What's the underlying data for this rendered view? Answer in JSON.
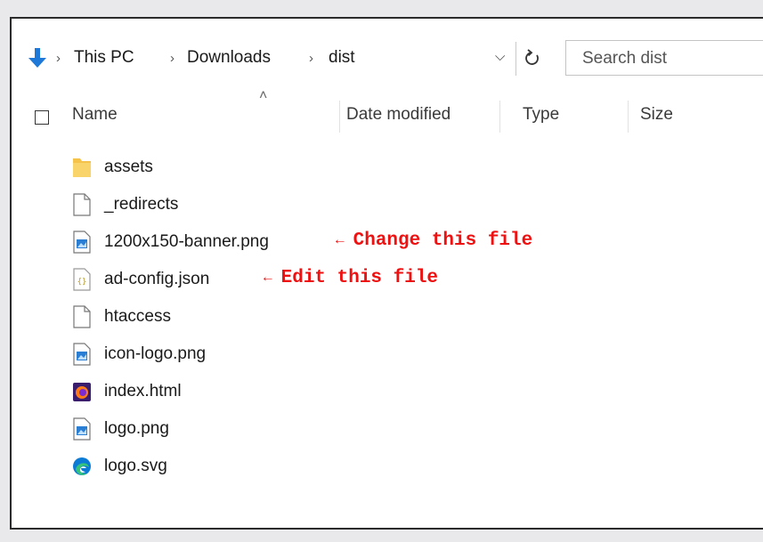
{
  "address": {
    "crumbs": [
      "This PC",
      "Downloads",
      "dist"
    ],
    "separator": "›",
    "search_placeholder": "Search dist"
  },
  "columns": {
    "name": "Name",
    "date_modified": "Date modified",
    "type": "Type",
    "size": "Size"
  },
  "files": [
    {
      "name": "assets",
      "icon": "folder-icon"
    },
    {
      "name": "_redirects",
      "icon": "file-icon"
    },
    {
      "name": "1200x150-banner.png",
      "icon": "image-file-icon"
    },
    {
      "name": "ad-config.json",
      "icon": "json-file-icon"
    },
    {
      "name": "htaccess",
      "icon": "file-icon"
    },
    {
      "name": "icon-logo.png",
      "icon": "image-file-icon"
    },
    {
      "name": "index.html",
      "icon": "firefox-html-icon"
    },
    {
      "name": "logo.png",
      "icon": "image-file-icon"
    },
    {
      "name": "logo.svg",
      "icon": "edge-svg-icon"
    }
  ],
  "annotations": {
    "banner": {
      "arrow": "←",
      "text": "Change this file"
    },
    "config": {
      "arrow": "←",
      "text": "Edit this file"
    }
  },
  "colors": {
    "annotation": "#ee1111",
    "nav_arrow": "#1e78d7",
    "folder": "#f5c24a"
  }
}
